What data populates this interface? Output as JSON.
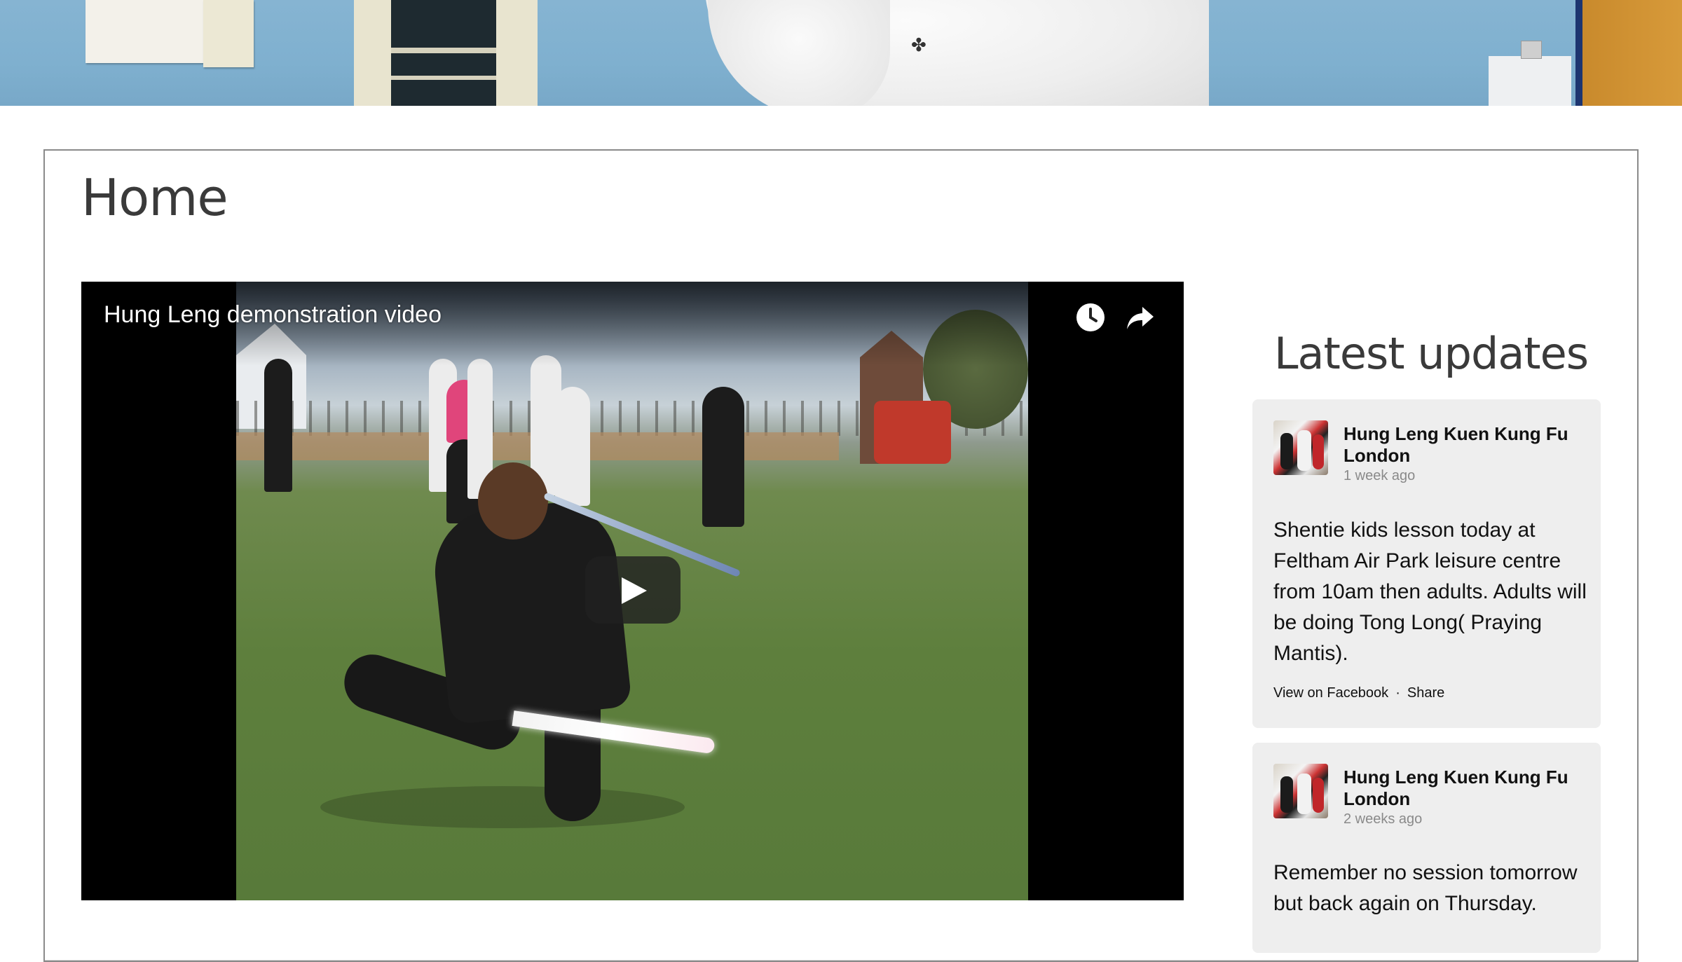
{
  "page": {
    "title": "Home"
  },
  "video": {
    "title": "Hung Leng demonstration video",
    "icons": [
      "clock-icon",
      "share-arrow-icon",
      "play-icon"
    ]
  },
  "sidebar": {
    "title": "Latest updates",
    "posts": [
      {
        "author": "Hung Leng Kuen Kung Fu London",
        "time": "1 week ago",
        "text": "Shentie kids lesson today at Feltham Air Park leisure centre from 10am then adults. Adults will be doing Tong Long( Praying Mantis).",
        "view_label": "View on Facebook",
        "separator": "·",
        "share_label": "Share"
      },
      {
        "author": "Hung Leng Kuen Kung Fu London",
        "time": "2 weeks ago",
        "text": "Remember no session tomorrow but back again on Thursday."
      }
    ]
  },
  "colors": {
    "heading": "#3a3a3a",
    "card_border": "#8a8a8a",
    "post_background": "#eeeeee",
    "video_background": "#000000",
    "hero_wall": "#86b4d2"
  }
}
